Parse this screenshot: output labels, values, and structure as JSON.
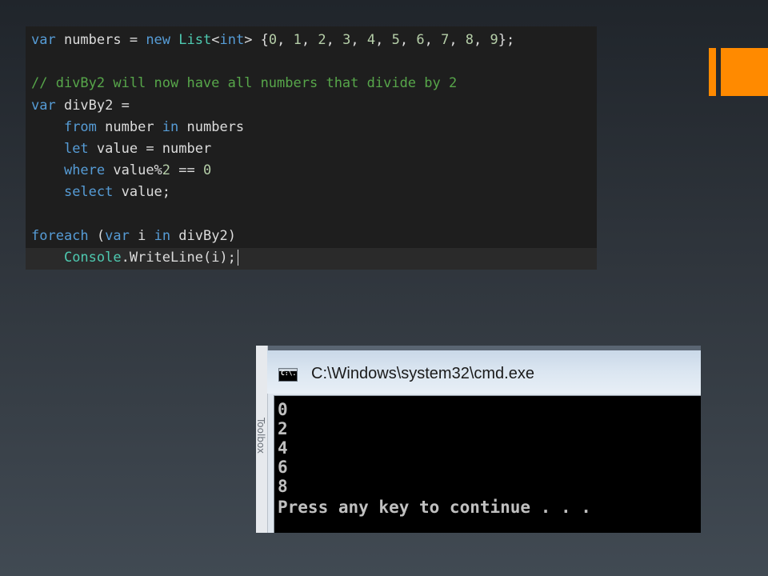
{
  "accent": {
    "color": "#ff8a00"
  },
  "editor": {
    "background": "#1e1e1e",
    "lines": [
      {
        "tokens": [
          {
            "t": "var",
            "c": "kw"
          },
          {
            "t": " numbers = ",
            "c": "plain"
          },
          {
            "t": "new",
            "c": "kw"
          },
          {
            "t": " ",
            "c": "plain"
          },
          {
            "t": "List",
            "c": "type"
          },
          {
            "t": "<",
            "c": "plain"
          },
          {
            "t": "int",
            "c": "kw"
          },
          {
            "t": "> {",
            "c": "plain"
          },
          {
            "t": "0",
            "c": "num"
          },
          {
            "t": ", ",
            "c": "plain"
          },
          {
            "t": "1",
            "c": "num"
          },
          {
            "t": ", ",
            "c": "plain"
          },
          {
            "t": "2",
            "c": "num"
          },
          {
            "t": ", ",
            "c": "plain"
          },
          {
            "t": "3",
            "c": "num"
          },
          {
            "t": ", ",
            "c": "plain"
          },
          {
            "t": "4",
            "c": "num"
          },
          {
            "t": ", ",
            "c": "plain"
          },
          {
            "t": "5",
            "c": "num"
          },
          {
            "t": ", ",
            "c": "plain"
          },
          {
            "t": "6",
            "c": "num"
          },
          {
            "t": ", ",
            "c": "plain"
          },
          {
            "t": "7",
            "c": "num"
          },
          {
            "t": ", ",
            "c": "plain"
          },
          {
            "t": "8",
            "c": "num"
          },
          {
            "t": ", ",
            "c": "plain"
          },
          {
            "t": "9",
            "c": "num"
          },
          {
            "t": "};",
            "c": "plain"
          }
        ]
      },
      {
        "tokens": []
      },
      {
        "tokens": [
          {
            "t": "// divBy2 will now have all numbers that divide by 2",
            "c": "cm"
          }
        ]
      },
      {
        "tokens": [
          {
            "t": "var",
            "c": "kw"
          },
          {
            "t": " divBy2 =",
            "c": "plain"
          }
        ]
      },
      {
        "tokens": [
          {
            "t": "    ",
            "c": "plain"
          },
          {
            "t": "from",
            "c": "kw"
          },
          {
            "t": " number ",
            "c": "plain"
          },
          {
            "t": "in",
            "c": "kw"
          },
          {
            "t": " numbers",
            "c": "plain"
          }
        ]
      },
      {
        "tokens": [
          {
            "t": "    ",
            "c": "plain"
          },
          {
            "t": "let",
            "c": "kw"
          },
          {
            "t": " value = number",
            "c": "plain"
          }
        ]
      },
      {
        "tokens": [
          {
            "t": "    ",
            "c": "plain"
          },
          {
            "t": "where",
            "c": "kw"
          },
          {
            "t": " value%",
            "c": "plain"
          },
          {
            "t": "2",
            "c": "num"
          },
          {
            "t": " == ",
            "c": "plain"
          },
          {
            "t": "0",
            "c": "num"
          }
        ]
      },
      {
        "tokens": [
          {
            "t": "    ",
            "c": "plain"
          },
          {
            "t": "select",
            "c": "kw"
          },
          {
            "t": " value;",
            "c": "plain"
          }
        ]
      },
      {
        "tokens": []
      },
      {
        "tokens": [
          {
            "t": "foreach",
            "c": "kw"
          },
          {
            "t": " (",
            "c": "plain"
          },
          {
            "t": "var",
            "c": "kw"
          },
          {
            "t": " i ",
            "c": "plain"
          },
          {
            "t": "in",
            "c": "kw"
          },
          {
            "t": " divBy2)",
            "c": "plain"
          }
        ]
      },
      {
        "tokens": [
          {
            "t": "    ",
            "c": "plain"
          },
          {
            "t": "Console",
            "c": "type"
          },
          {
            "t": ".WriteLine(i);",
            "c": "plain"
          }
        ],
        "caret": true
      }
    ]
  },
  "console": {
    "background_label": "Toolbox",
    "icon_text": "C:\\.",
    "title": "C:\\Windows\\system32\\cmd.exe",
    "output": [
      "0",
      "2",
      "4",
      "6",
      "8"
    ],
    "prompt": "Press any key to continue . . ."
  }
}
